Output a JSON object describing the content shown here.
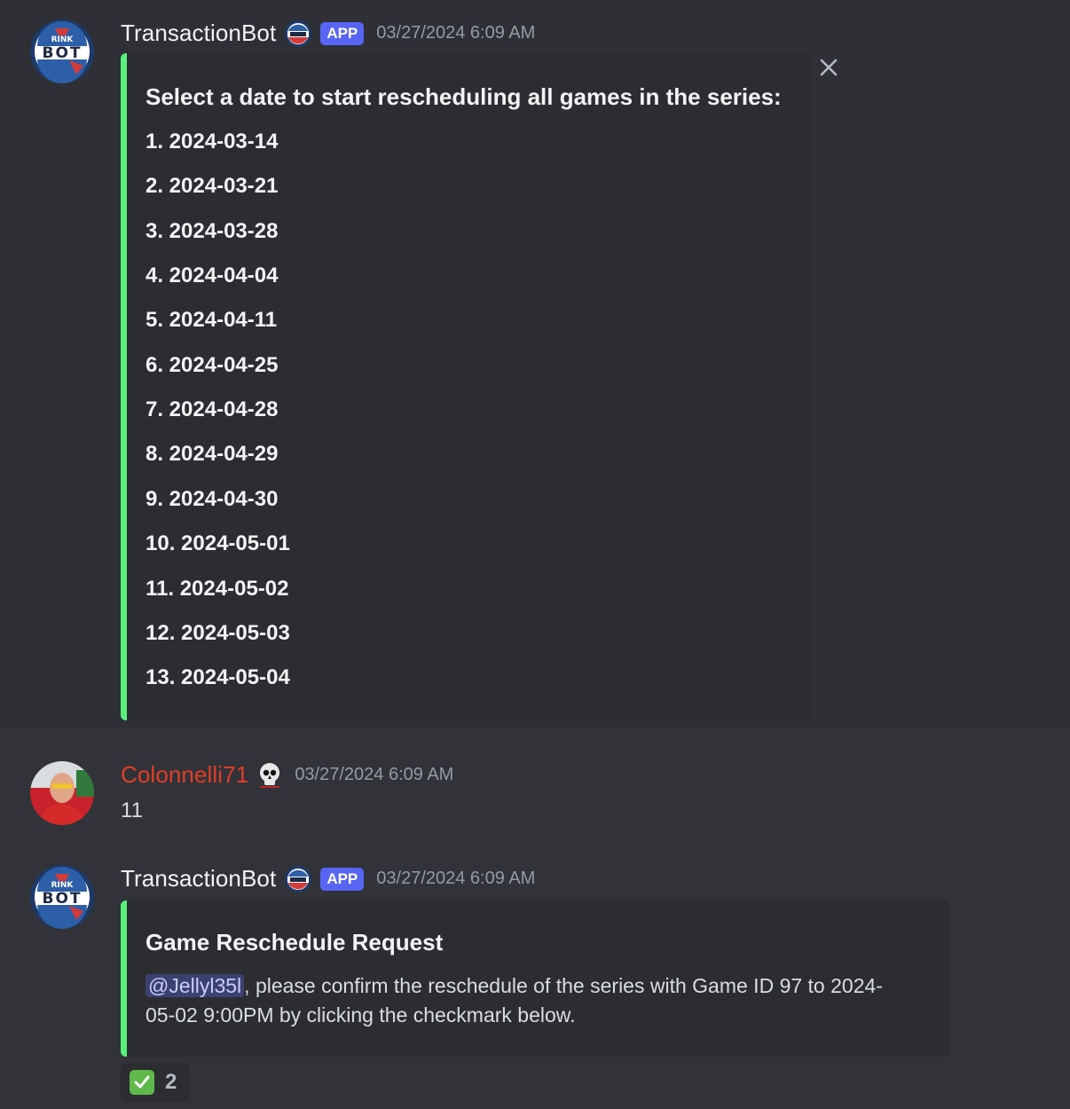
{
  "messages": [
    {
      "author": "TransactionBot",
      "app_tag": "APP",
      "timestamp": "03/27/2024 6:09 AM",
      "avatar_text": {
        "top": "RINK",
        "main": "BOT"
      },
      "embed": {
        "title": "Select a date to start rescheduling all games in the series:",
        "dates": [
          "1. 2024-03-14",
          "2. 2024-03-21",
          "3. 2024-03-28",
          "4. 2024-04-04",
          "5. 2024-04-11",
          "6. 2024-04-25",
          "7. 2024-04-28",
          "8. 2024-04-29",
          "9. 2024-04-30",
          "10. 2024-05-01",
          "11. 2024-05-02",
          "12. 2024-05-03",
          "13. 2024-05-04"
        ],
        "accent_color": "#57f27a"
      }
    },
    {
      "author": "Colonnelli71",
      "timestamp": "03/27/2024 6:09 AM",
      "content": "11",
      "name_color": "#e23d28"
    },
    {
      "author": "TransactionBot",
      "app_tag": "APP",
      "timestamp": "03/27/2024 6:09 AM",
      "avatar_text": {
        "top": "RINK",
        "main": "BOT"
      },
      "embed": {
        "title": "Game Reschedule Request",
        "mention": "@Jellyl35l",
        "description_line1": ", please confirm the reschedule of the series with Game ID 97 to 2024-",
        "description_line2": "05-02 9:00PM by clicking the checkmark below."
      },
      "reaction": {
        "emoji": "white-check-mark",
        "count": "2"
      }
    }
  ],
  "colors": {
    "background": "#313338",
    "embed_bg": "#2b2d31",
    "accent_green": "#57f27a",
    "app_tag": "#5865f2"
  }
}
